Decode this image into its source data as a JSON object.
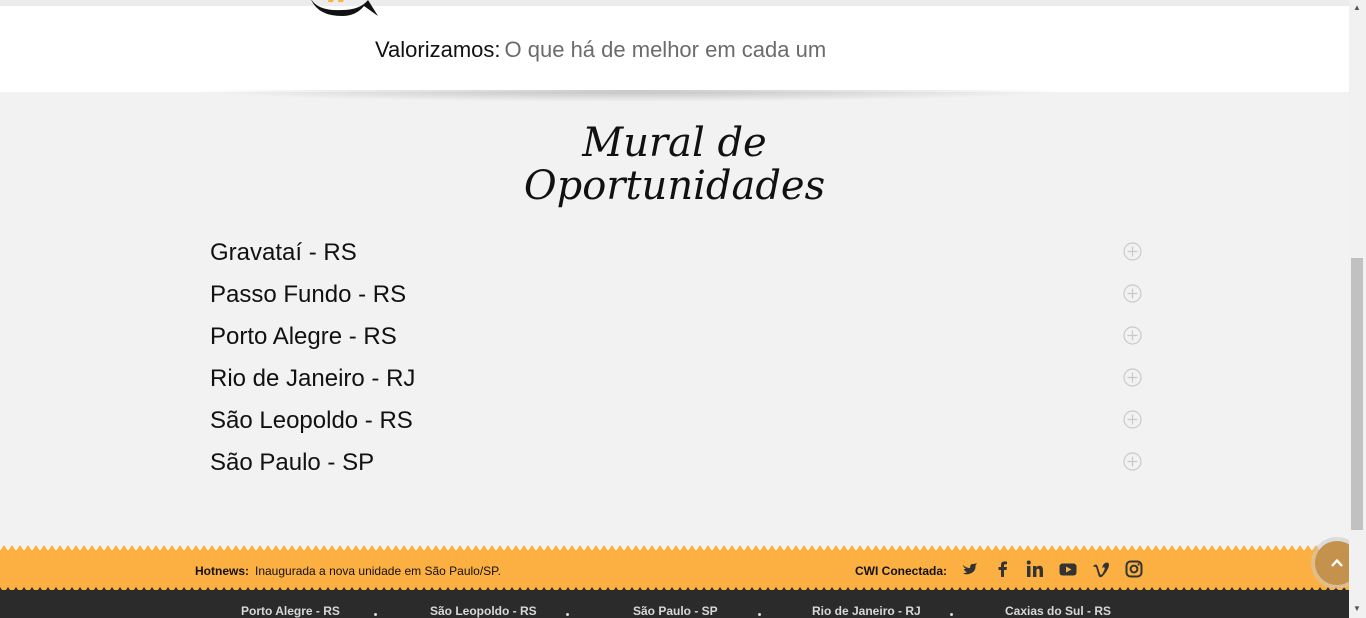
{
  "values": {
    "label": "Valorizamos:",
    "value": "O que há de melhor em cada um"
  },
  "mural": {
    "title_line1": "Mural de",
    "title_line2": "Oportunidades",
    "cities": [
      "Gravataí - RS",
      "Passo Fundo - RS",
      "Porto Alegre - RS",
      "Rio de Janeiro - RJ",
      "São Leopoldo - RS",
      "São Paulo - SP"
    ]
  },
  "hotnews": {
    "label": "Hotnews:",
    "text": "Inaugurada a nova unidade em São Paulo/SP."
  },
  "connected": {
    "label": "CWI Conectada:",
    "icons": [
      "twitter-icon",
      "facebook-icon",
      "linkedin-icon",
      "youtube-icon",
      "vimeo-icon",
      "instagram-icon"
    ]
  },
  "footer": {
    "links": [
      "Porto Alegre - RS",
      "São Leopoldo - RS",
      "São Paulo - SP",
      "Rio de Janeiro - RJ",
      "Caxias do Sul - RS"
    ]
  },
  "colors": {
    "accent": "#fcb041",
    "dark": "#2b2b2b",
    "background": "#f2f2f2"
  }
}
